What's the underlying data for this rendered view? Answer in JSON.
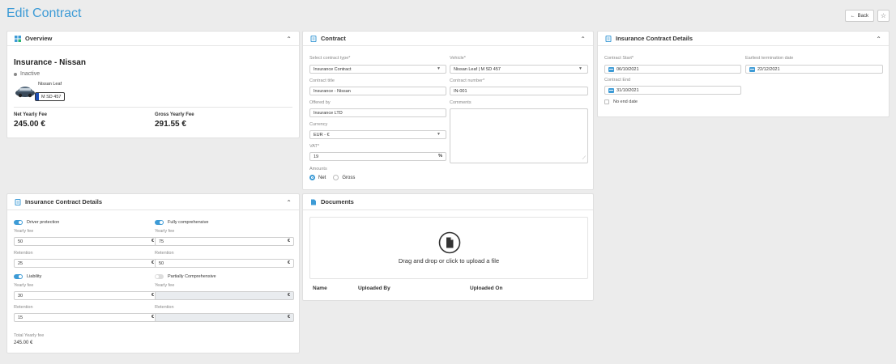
{
  "page": {
    "title": "Edit Contract",
    "back_label": "Back",
    "back_icon": "←",
    "star_icon": "☆"
  },
  "overview": {
    "title": "Overview",
    "name": "Insurance - Nissan",
    "status": "Inactive",
    "vehicle_model": "Nissan Leaf",
    "plate": "M SD 457",
    "net_label": "Net Yearly Fee",
    "net_value": "245.00 €",
    "gross_label": "Gross Yearly Fee",
    "gross_value": "291.55 €"
  },
  "contract": {
    "title": "Contract",
    "type_label": "Select contract type*",
    "type_value": "Insurance Contract",
    "vehicle_label": "Vehicle*",
    "vehicle_value": "Nissan Leaf | M SD 457",
    "title_label": "Contract title",
    "title_value": "Insurance - Nissan",
    "number_label": "Contract number*",
    "number_value": "IN-001",
    "offered_label": "Offered by",
    "offered_value": "Insurance LTD",
    "comments_label": "Comments",
    "currency_label": "Currency",
    "currency_value": "EUR - €",
    "vat_label": "VAT*",
    "vat_value": "19",
    "vat_suffix": "%",
    "amounts_label": "Amounts",
    "net_option": "Net",
    "gross_option": "Gross"
  },
  "details_top": {
    "title": "Insurance Contract Details",
    "start_label": "Contract Start*",
    "start_value": "06/10/2021",
    "earliest_label": "Earliest termination date",
    "earliest_value": "22/12/2021",
    "end_label": "Contract End",
    "end_value": "31/10/2021",
    "no_end_label": "No end date"
  },
  "details_bottom": {
    "title": "Insurance Contract Details",
    "currency_suffix": "€",
    "yearly_fee_label": "Yearly fee",
    "retention_label": "Retention",
    "coverages": [
      {
        "name": "Driver protection",
        "enabled": true,
        "yearly_fee": "50",
        "retention": "25"
      },
      {
        "name": "Fully comprehensive",
        "enabled": true,
        "yearly_fee": "75",
        "retention": "50"
      },
      {
        "name": "Liability",
        "enabled": true,
        "yearly_fee": "30",
        "retention": "15"
      },
      {
        "name": "Partially Comprehensive",
        "enabled": false,
        "yearly_fee": "",
        "retention": ""
      }
    ],
    "total_label": "Total Yearly fee",
    "total_value": "245.00 €"
  },
  "documents": {
    "title": "Documents",
    "dropzone_text": "Drag and drop or click to upload a file",
    "columns": [
      "Name",
      "Uploaded By",
      "Uploaded On"
    ]
  },
  "colors": {
    "accent": "#3d9bd6",
    "background": "#ececec"
  }
}
